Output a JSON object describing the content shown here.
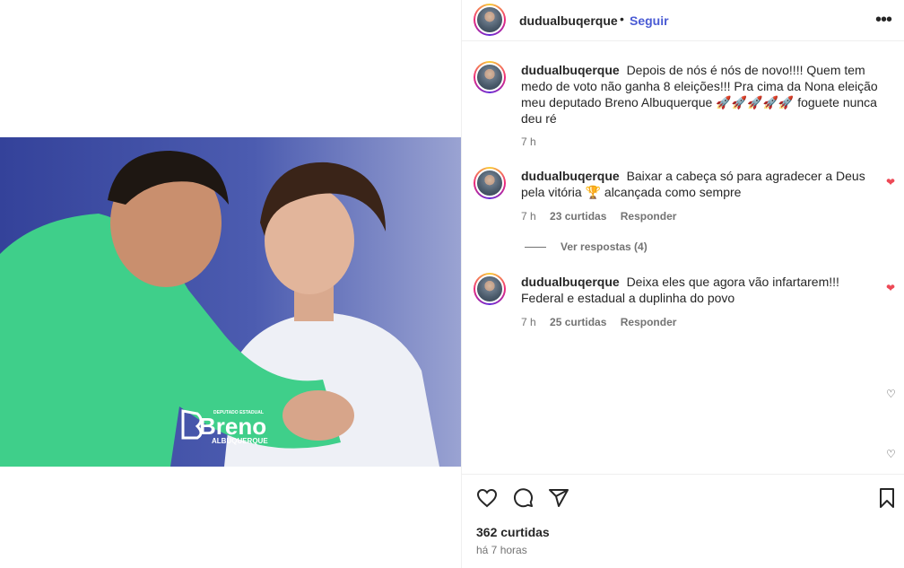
{
  "post": {
    "username": "dudualbuqerque",
    "follow_label": "Seguir",
    "dot": "•",
    "more_icon": "more-horizontal-icon",
    "photo_brand_top": "DEPUTADO ESTADUAL",
    "photo_brand_name": "Breno",
    "photo_brand_sub": "ALBUQUERQUE"
  },
  "caption": {
    "username": "dudualbuqerque",
    "text": "Depois de nós é nós de novo!!!! Quem tem medo de voto não ganha 8 eleições!!! Pra cima da Nona eleição meu deputado Breno Albuquerque 🚀🚀🚀🚀🚀 foguete nunca deu ré",
    "time": "7 h"
  },
  "comments": [
    {
      "username": "dudualbuqerque",
      "text": "Baixar a cabeça só para agradecer a Deus pela vitória 🏆 alcançada como sempre",
      "time": "7 h",
      "likes": "23 curtidas",
      "reply_label": "Responder",
      "liked": true
    },
    {
      "username": "dudualbuqerque",
      "text": "Deixa eles que agora vão infartarem!!! Federal e estadual a duplinha do povo",
      "time": "7 h",
      "likes": "25 curtidas",
      "reply_label": "Responder",
      "liked": true
    }
  ],
  "view_replies": "Ver respostas (4)",
  "actions": {
    "like_icon": "heart-icon",
    "comment_icon": "comment-icon",
    "share_icon": "share-icon",
    "save_icon": "bookmark-icon",
    "likes": "362 curtidas",
    "time": "há 7 horas"
  },
  "colors": {
    "accent": "#4a5bd4",
    "liked": "#ed4956",
    "muted": "#737373"
  }
}
